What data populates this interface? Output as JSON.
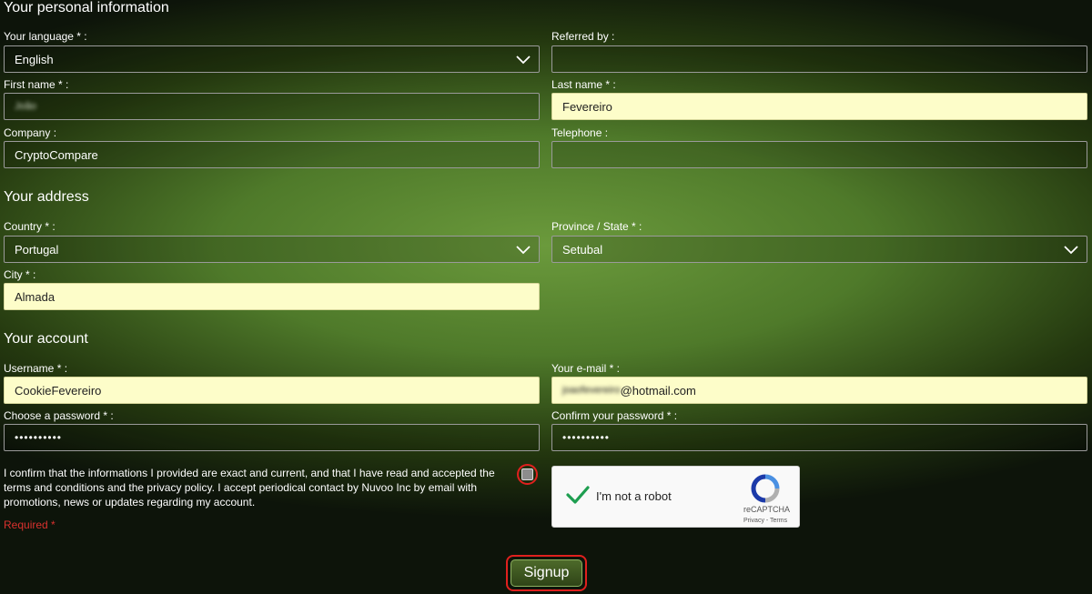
{
  "sections": {
    "personal": "Your personal information",
    "address": "Your address",
    "account": "Your account"
  },
  "fields": {
    "language": {
      "label": "Your language * :",
      "value": "English"
    },
    "referred_by": {
      "label": "Referred by :",
      "value": ""
    },
    "first_name": {
      "label": "First name * :",
      "value": "João"
    },
    "last_name": {
      "label": "Last name * :",
      "value": "Fevereiro"
    },
    "company": {
      "label": "Company :",
      "value": "CryptoCompare"
    },
    "telephone": {
      "label": "Telephone :",
      "value": ""
    },
    "country": {
      "label": "Country * :",
      "value": "Portugal"
    },
    "province": {
      "label": "Province / State * :",
      "value": "Setubal"
    },
    "city": {
      "label": "City * :",
      "value": "Almada"
    },
    "username": {
      "label": "Username * :",
      "value": "CookieFevereiro"
    },
    "email": {
      "label": "Your e-mail * :",
      "value_hidden": "joaofevereiro",
      "value_domain": "@hotmail.com"
    },
    "password": {
      "label": "Choose a password * :",
      "value": "••••••••••"
    },
    "confirm_password": {
      "label": "Confirm your password * :",
      "value": "••••••••••"
    }
  },
  "consent": {
    "text": "I confirm that the informations I provided are exact and current, and that I have read and accepted the terms and conditions and the privacy policy. I accept periodical contact by Nuvoo Inc by email with promotions, news or updates regarding my account.",
    "required": "Required *"
  },
  "captcha": {
    "label": "I'm not a robot",
    "brand": "reCAPTCHA",
    "links": "Privacy - Terms"
  },
  "signup_label": "Signup",
  "colors": {
    "accent_red": "#e0201e",
    "field_highlight": "#fdfdc9",
    "green_button": "#3e5720"
  }
}
